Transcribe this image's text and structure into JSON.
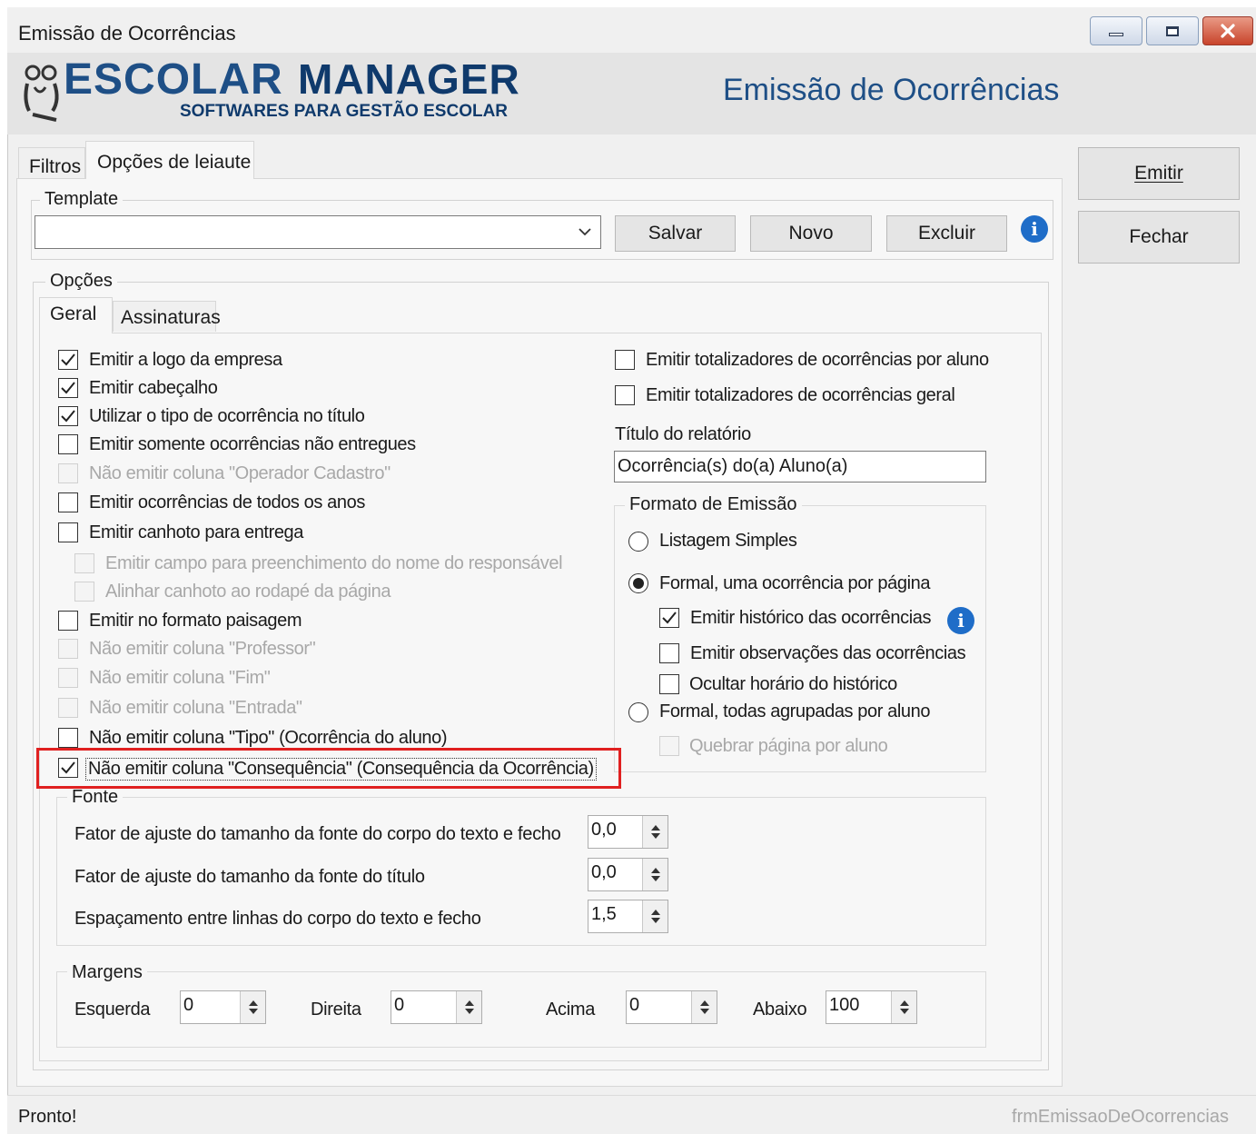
{
  "window": {
    "title": "Emissão de Ocorrências",
    "controls": {
      "minimize": "minimize-icon",
      "maximize": "maximize-icon",
      "close": "close-icon"
    }
  },
  "banner": {
    "logo_part1": "ESCOLAR",
    "logo_part2": "MANAGER",
    "logo_tagline": "SOFTWARES PARA GESTÃO ESCOLAR",
    "page_title": "Emissão de Ocorrências",
    "title_color": "#1e4f86",
    "logo_color": "#1e4f86"
  },
  "tabs": [
    {
      "label": "Filtros",
      "active": false
    },
    {
      "label": "Opções de leiaute",
      "active": true
    }
  ],
  "side_buttons": {
    "emitir": "Emitir",
    "fechar": "Fechar"
  },
  "template": {
    "group_label": "Template",
    "select_value": "",
    "save": "Salvar",
    "new": "Novo",
    "delete": "Excluir"
  },
  "opcoes": {
    "group_label": "Opções",
    "subtabs": [
      {
        "label": "Geral",
        "active": true
      },
      {
        "label": "Assinaturas",
        "active": false
      }
    ],
    "left_checks": [
      {
        "label": "Emitir a logo da empresa",
        "checked": true,
        "enabled": true,
        "indent": false
      },
      {
        "label": "Emitir cabeçalho",
        "checked": true,
        "enabled": true,
        "indent": false
      },
      {
        "label": "Utilizar o tipo de ocorrência no título",
        "checked": true,
        "enabled": true,
        "indent": false
      },
      {
        "label": "Emitir somente ocorrências não entregues",
        "checked": false,
        "enabled": true,
        "indent": false
      },
      {
        "label": "Não emitir coluna \"Operador Cadastro\"",
        "checked": false,
        "enabled": false,
        "indent": false
      },
      {
        "label": "Emitir ocorrências de todos os anos",
        "checked": false,
        "enabled": true,
        "indent": false
      },
      {
        "label": "Emitir canhoto para entrega",
        "checked": false,
        "enabled": true,
        "indent": false
      },
      {
        "label": "Emitir campo para preenchimento do nome do responsável",
        "checked": false,
        "enabled": false,
        "indent": true
      },
      {
        "label": "Alinhar canhoto ao rodapé da página",
        "checked": false,
        "enabled": false,
        "indent": true
      },
      {
        "label": "Emitir no formato paisagem",
        "checked": false,
        "enabled": true,
        "indent": false
      },
      {
        "label": "Não emitir coluna \"Professor\"",
        "checked": false,
        "enabled": false,
        "indent": false
      },
      {
        "label": "Não emitir coluna \"Fim\"",
        "checked": false,
        "enabled": false,
        "indent": false
      },
      {
        "label": "Não emitir coluna \"Entrada\"",
        "checked": false,
        "enabled": false,
        "indent": false
      },
      {
        "label": "Não emitir coluna \"Tipo\" (Ocorrência do aluno)",
        "checked": false,
        "enabled": true,
        "indent": false
      },
      {
        "label": "Não emitir coluna \"Consequência\" (Consequência da Ocorrência)",
        "checked": true,
        "enabled": true,
        "indent": false,
        "highlighted": true
      }
    ],
    "right_checks": [
      {
        "label": "Emitir totalizadores de ocorrências por aluno",
        "checked": false
      },
      {
        "label": "Emitir totalizadores de ocorrências geral",
        "checked": false
      }
    ],
    "titulo_label": "Título do relatório",
    "titulo_value": "Ocorrência(s) do(a) Aluno(a)",
    "formato": {
      "group_label": "Formato de Emissão",
      "radio1": "Listagem Simples",
      "radio2": "Formal, uma ocorrência por página",
      "sub1": "Emitir histórico das ocorrências",
      "sub2": "Emitir observações das ocorrências",
      "sub3": "Ocultar horário do histórico",
      "radio3": "Formal, todas agrupadas por aluno",
      "sub4": "Quebrar página por aluno",
      "selected": "Formal, uma ocorrência por página"
    },
    "highlight_color": "#e02020"
  },
  "fonte": {
    "group_label": "Fonte",
    "rows": [
      {
        "label": "Fator de ajuste do tamanho da fonte do corpo do texto e fecho",
        "value": "0,0"
      },
      {
        "label": "Fator de ajuste do tamanho da fonte do título",
        "value": "0,0"
      },
      {
        "label": "Espaçamento entre linhas do corpo do texto e fecho",
        "value": "1,5"
      }
    ]
  },
  "margens": {
    "group_label": "Margens",
    "esquerda_label": "Esquerda",
    "esquerda": "0",
    "direita_label": "Direita",
    "direita": "0",
    "acima_label": "Acima",
    "acima": "0",
    "abaixo_label": "Abaixo",
    "abaixo": "100"
  },
  "status": {
    "text": "Pronto!",
    "form_name": "frmEmissaoDeOcorrencias"
  }
}
